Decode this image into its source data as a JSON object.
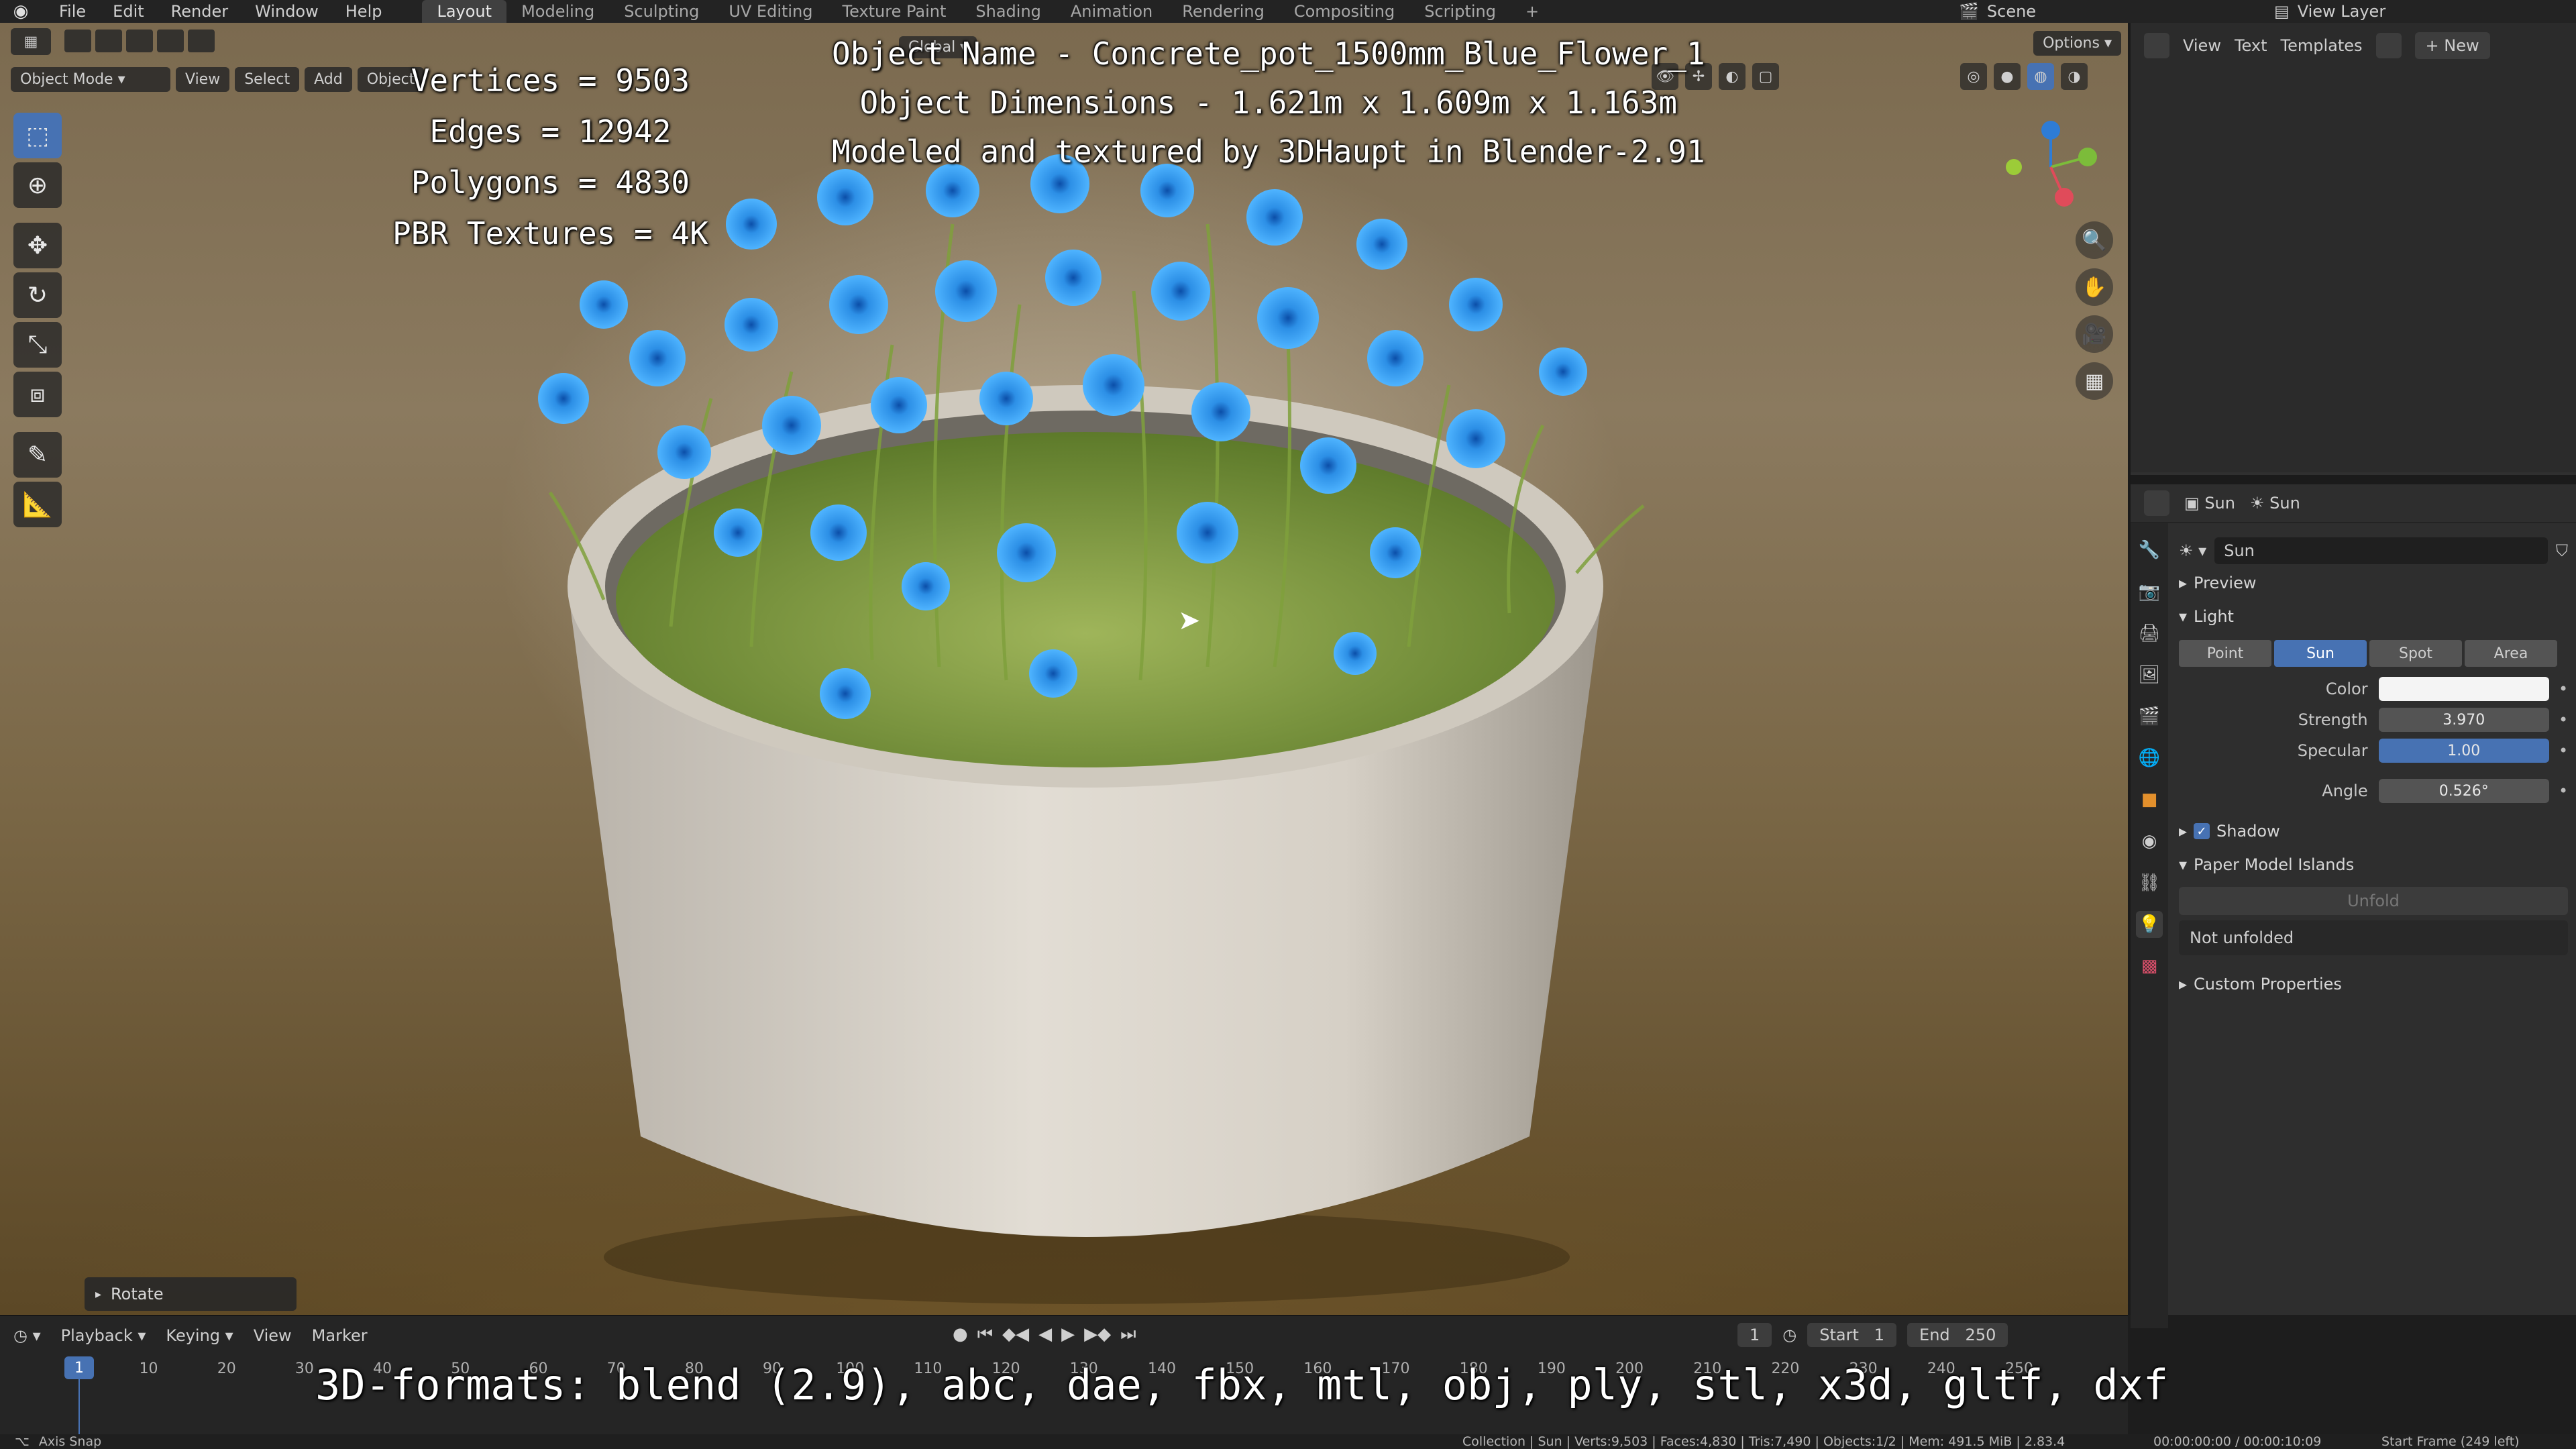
{
  "topbar": {
    "menus": [
      "File",
      "Edit",
      "Render",
      "Window",
      "Help"
    ],
    "workspaces": [
      "Layout",
      "Modeling",
      "Sculpting",
      "UV Editing",
      "Texture Paint",
      "Shading",
      "Animation",
      "Rendering",
      "Compositing",
      "Scripting"
    ],
    "active_workspace": "Layout",
    "scene_label": "Scene",
    "view_layer_label": "View Layer"
  },
  "viewport": {
    "mode": "Object Mode",
    "menus": [
      "View",
      "Select",
      "Add",
      "Object"
    ],
    "transform_orientation": "Global",
    "options_label": "Options",
    "rotate_panel_label": "Rotate"
  },
  "overlay": {
    "stats": [
      "Vertices = 9503",
      "Edges = 12942",
      "Polygons = 4830",
      "PBR Textures = 4K"
    ],
    "info": [
      "Object Name - Concrete_pot_1500mm_Blue_Flower_1",
      "Object Dimensions -  1.621m x 1.609m x 1.163m",
      "Modeled and textured by 3DHaupt in Blender-2.91"
    ],
    "formats": "3D-formats: blend (2.9), abc, dae, fbx, mtl, obj, ply, stl, x3d, gltf, dxf"
  },
  "text_editor": {
    "menus": [
      "View",
      "Text",
      "Templates"
    ],
    "new_label": "New"
  },
  "properties": {
    "breadcrumb_object": "Sun",
    "breadcrumb_data": "Sun",
    "light_name": "Sun",
    "sections": {
      "preview": "Preview",
      "light": "Light",
      "shadow": "Shadow",
      "paper_model": "Paper Model Islands",
      "custom_props": "Custom Properties"
    },
    "light_types": [
      "Point",
      "Sun",
      "Spot",
      "Area"
    ],
    "active_light_type": "Sun",
    "fields": {
      "color_label": "Color",
      "strength_label": "Strength",
      "strength_value": "3.970",
      "specular_label": "Specular",
      "specular_value": "1.00",
      "angle_label": "Angle",
      "angle_value": "0.526°"
    },
    "unfold_label": "Unfold",
    "not_unfolded": "Not unfolded",
    "color_value_hex": "#ffffff"
  },
  "timeline": {
    "menus": [
      "Playback",
      "Keying",
      "View",
      "Marker"
    ],
    "current_frame": "1",
    "start_label": "Start",
    "start_value": "1",
    "end_label": "End",
    "end_value": "250",
    "ruler_ticks": [
      "1",
      "10",
      "20",
      "30",
      "40",
      "50",
      "60",
      "70",
      "80",
      "90",
      "100",
      "110",
      "120",
      "130",
      "140",
      "150",
      "160",
      "170",
      "180",
      "190",
      "200",
      "210",
      "220",
      "230",
      "240",
      "250"
    ]
  },
  "statusbar": {
    "hint": "Axis Snap",
    "stats": "Collection | Sun | Verts:9,503 | Faces:4,830 | Tris:7,490 | Objects:1/2 | Mem: 491.5 MiB | 2.83.4",
    "time": "00:00:00:00 / 00:00:10:09",
    "start_frame": "Start Frame (249 left)"
  },
  "colors": {
    "accent": "#4772b3",
    "flower_blue": "#2c8fe6",
    "pot_concrete": "#d8d3cb"
  }
}
